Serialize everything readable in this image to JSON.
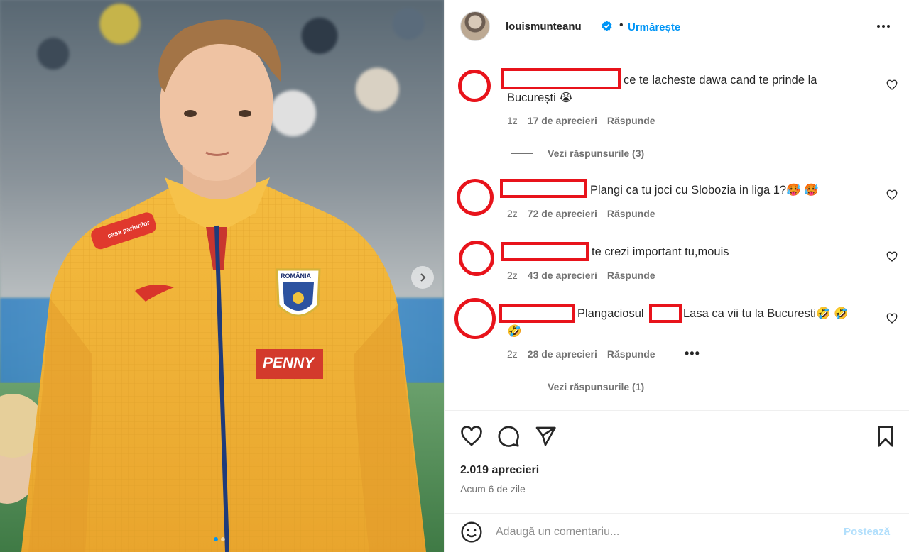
{
  "post": {
    "username": "louismunteanu_",
    "follow_label": "Urmărește",
    "separator": "•",
    "likes": "2.019 aprecieri",
    "posted": "Acum 6 de zile",
    "photo": {
      "slides": 2,
      "active_slide": 1,
      "jersey_sponsor": "PENNY",
      "badge_text": "ROMÂNIA",
      "chest_logo": "casa pariurilor"
    }
  },
  "comments": [
    {
      "text_line1": "ce te lacheste dawa cand te prinde la",
      "text_line2": "București 😭",
      "time": "1z",
      "likes": "17 de aprecieri",
      "reply": "Răspunde",
      "view_replies": "Vezi răspunsurile (3)"
    },
    {
      "text_line1": "Plangi ca tu joci cu Slobozia in liga 1?🥵 🥵",
      "time": "2z",
      "likes": "72 de aprecieri",
      "reply": "Răspunde"
    },
    {
      "text_line1": "te crezi important tu,mouis",
      "time": "2z",
      "likes": "43 de aprecieri",
      "reply": "Răspunde"
    },
    {
      "text_part_a": "Plangaciosul",
      "text_part_b": "Lasa ca vii tu la Bucuresti🤣 🤣",
      "text_line2": "🤣",
      "time": "2z",
      "likes": "28 de aprecieri",
      "reply": "Răspunde",
      "more": "•••",
      "view_replies": "Vezi răspunsurile (1)"
    }
  ],
  "composer": {
    "placeholder": "Adaugă un comentariu...",
    "post_label": "Postează"
  },
  "colors": {
    "accent": "#0095f6",
    "redaction": "#e8131b",
    "jersey": "#f2b53a"
  }
}
